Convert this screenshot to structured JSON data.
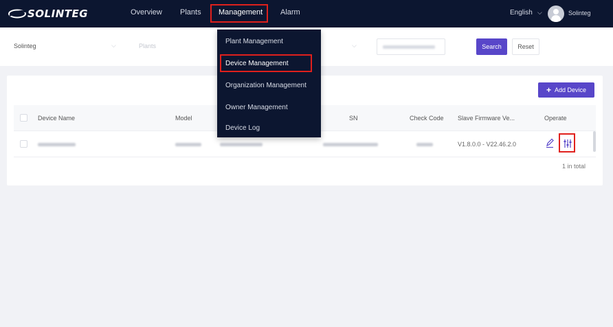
{
  "brand": {
    "logo_text": "SOLINTEG"
  },
  "nav": {
    "items": [
      {
        "label": "Overview"
      },
      {
        "label": "Plants"
      },
      {
        "label": "Management"
      },
      {
        "label": "Alarm"
      }
    ],
    "active": "Management",
    "language": "English",
    "username": "Solinteg"
  },
  "filters": {
    "organization": "Solinteg",
    "plants_placeholder": "Plants",
    "search_label": "Search",
    "reset_label": "Reset"
  },
  "management_menu": {
    "items": [
      {
        "label": "Plant Management"
      },
      {
        "label": "Device Management"
      },
      {
        "label": "Organization Management"
      },
      {
        "label": "Owner Management"
      },
      {
        "label": "Device Log"
      }
    ],
    "selected": "Device Management"
  },
  "toolbar": {
    "add_device_label": "Add Device"
  },
  "table": {
    "columns": [
      "Device Name",
      "Model",
      "SN",
      "Check Code",
      "Slave Firmware Ve...",
      "Operate"
    ],
    "rows": [
      {
        "firmware": "V1.8.0.0 - V22.46.2.0"
      }
    ],
    "total_text": "1 in total"
  },
  "colors": {
    "nav_bg": "#0c1630",
    "accent": "#5846c9",
    "highlight": "#e0201c",
    "page_bg": "#f1f2f6"
  },
  "icons": {
    "edit": "pencil-icon",
    "config": "sliders-icon",
    "add": "plus-icon",
    "language": "chevron-down-icon"
  }
}
